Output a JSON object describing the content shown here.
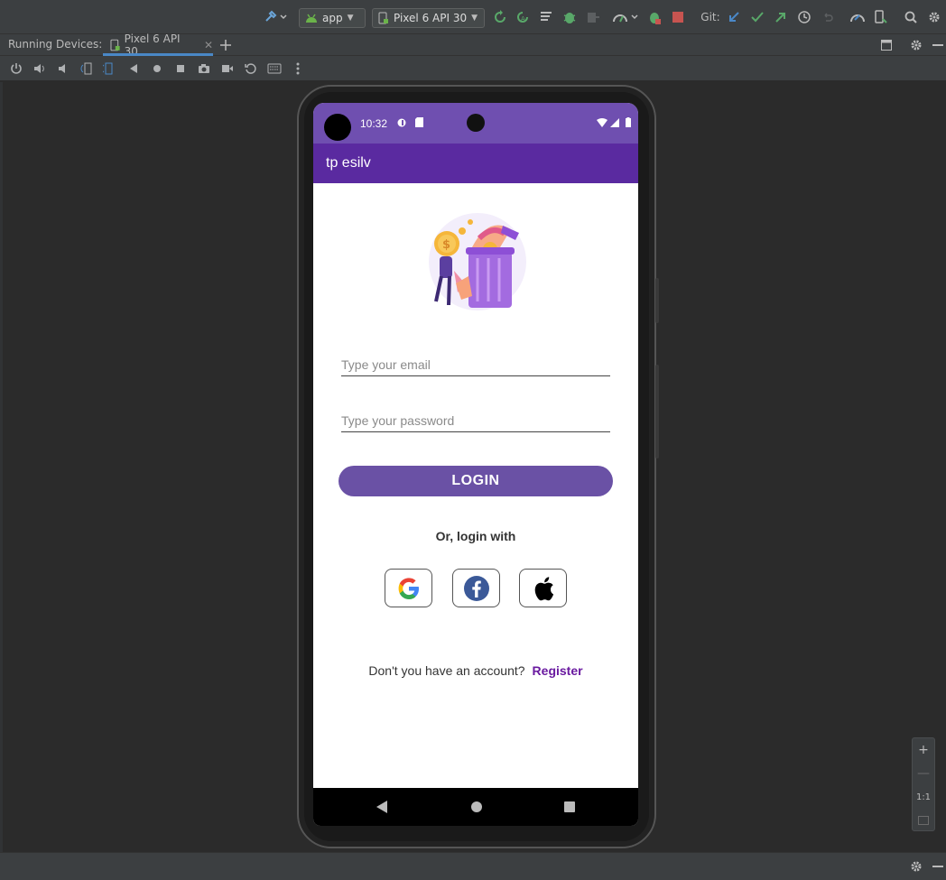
{
  "toolbar": {
    "app_config": "app",
    "device_select": "Pixel 6 API 30",
    "git_label": "Git:"
  },
  "tabs": {
    "running_devices_label": "Running Devices:",
    "active_tab": "Pixel 6 API 30"
  },
  "zoom": {
    "plus": "+",
    "minus": "—",
    "ratio": "1:1"
  },
  "phone": {
    "status_time": "10:32",
    "app_title": "tp esilv",
    "email_placeholder": "Type your email",
    "password_placeholder": "Type your password",
    "login_button": "LOGIN",
    "or_login_with": "Or, login with",
    "no_account_text": "Don't you have an account?",
    "register_link": "Register"
  },
  "colors": {
    "status_bar": "#6f4fb0",
    "app_bar": "#5a2aa0",
    "login_button": "#6a51a5",
    "register_link": "#6a1aa0",
    "ide_background": "#2b2b2b"
  }
}
